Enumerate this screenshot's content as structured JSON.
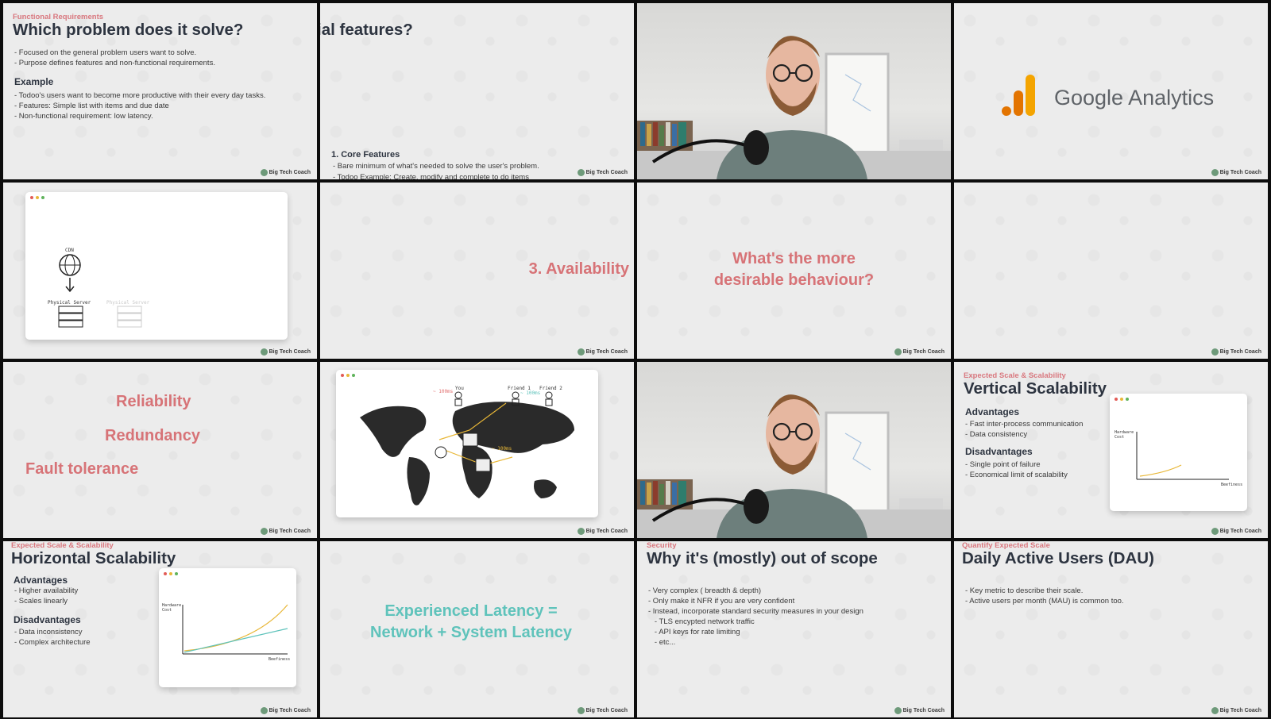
{
  "watermark": "Big Tech Coach",
  "colors": {
    "accent_red": "#d77377",
    "accent_teal": "#5fc3bb",
    "title_dark": "#2d3440",
    "analytics_orange": "#f4a400"
  },
  "t1": {
    "kicker": "Functional Requirements",
    "title": "Which problem does it solve?",
    "lines": [
      "- Focused on the general problem users want to solve.",
      "- Purpose defines features and non-functional requirements."
    ],
    "example_heading": "Example",
    "example_lines": [
      "- Todoo's users want to become more productive with their every day tasks.",
      "- Features: Simple list with items and due date",
      "- Non-functional requirement: low latency."
    ]
  },
  "t2": {
    "title_fragment": "ial features?",
    "section": "1. Core Features",
    "line": "- Bare minimum of what's needed to solve the user's problem.",
    "cut_line": "- Todoo Example: Create, modify and complete to do items"
  },
  "t4": {
    "brand": "Google Analytics"
  },
  "t5": {
    "cdn_label": "CDN",
    "server_label": "Physical Server",
    "server_label_faded": "Physical Server"
  },
  "t6": {
    "text": "3. Availability"
  },
  "t7": {
    "line1": "What's the more",
    "line2": "desirable behaviour?"
  },
  "t9": {
    "w1": "Reliability",
    "w2": "Redundancy",
    "w3": "Fault tolerance"
  },
  "t10": {
    "you_label": "You",
    "friend1_label": "Friend 1",
    "friend2_label": "Friend 2",
    "ms_you": "~ 100ms",
    "ms_friend": "~ 100ms",
    "ms_mid": "~ 100ms"
  },
  "t12": {
    "kicker": "Expected Scale & Scalability",
    "title": "Vertical Scalability",
    "adv_heading": "Advantages",
    "adv": [
      "- Fast inter-process communication",
      "- Data consistency"
    ],
    "dis_heading": "Disadvantages",
    "dis": [
      "- Single point of failure",
      "- Economical limit of scalability"
    ],
    "chart_ylabel": "Hardware Cost",
    "chart_xlabel": "Beefiness"
  },
  "t13": {
    "kicker": "Expected Scale & Scalability",
    "title": "Horizontal Scalability",
    "adv_heading": "Advantages",
    "adv": [
      "- Higher availability",
      "- Scales linearly"
    ],
    "dis_heading": "Disadvantages",
    "dis": [
      "- Data inconsistency",
      "- Complex architecture"
    ],
    "chart_ylabel": "Hardware Cost",
    "chart_xlabel": "Beefiness"
  },
  "t14": {
    "line1": "Experienced Latency =",
    "line2": "Network + System Latency"
  },
  "t15": {
    "kicker": "Security",
    "title": "Why it's (mostly) out of scope",
    "lines": [
      "- Very complex ( breadth & depth)",
      "- Only make it NFR if you are very confident",
      "- Instead, incorporate standard security measures in your design",
      "   - TLS encypted network traffic",
      "   - API keys for rate limiting",
      "   - etc..."
    ]
  },
  "t16": {
    "kicker": "Quantify Expected Scale",
    "title": "Daily Active Users (DAU)",
    "lines": [
      "- Key metric to describe their scale.",
      "- Active users per month (MAU) is common too."
    ]
  }
}
